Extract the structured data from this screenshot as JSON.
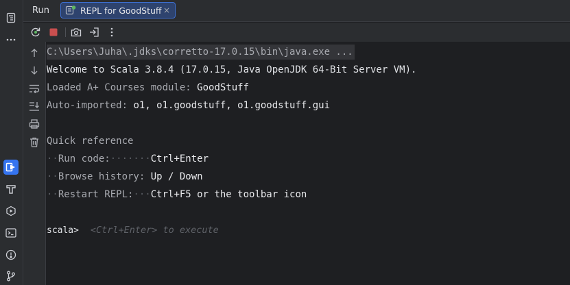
{
  "left_strip": {
    "items": [
      {
        "name": "structure-icon"
      },
      {
        "name": "more-icon"
      },
      {
        "name": "run-icon",
        "active": true
      },
      {
        "name": "build-icon"
      },
      {
        "name": "services-icon"
      },
      {
        "name": "terminal-icon"
      },
      {
        "name": "problems-icon"
      },
      {
        "name": "git-icon"
      }
    ]
  },
  "tabbar": {
    "title": "Run",
    "tab_label": "REPL for GoodStuff",
    "close_glyph": "×"
  },
  "toolbar": {
    "icons": [
      "rerun-icon",
      "stop-icon",
      "screenshot-icon",
      "exit-icon",
      "more-vertical-icon"
    ]
  },
  "gutter": {
    "icons": [
      "arrow-up-icon",
      "arrow-down-icon",
      "soft-wrap-icon",
      "scroll-to-end-icon",
      "print-icon",
      "trash-icon"
    ]
  },
  "console": {
    "command": "C:\\Users\\Juha\\.jdks\\corretto-17.0.15\\bin\\java.exe ...",
    "welcome": "Welcome to Scala 3.8.4 (17.0.15, Java OpenJDK 64-Bit Server VM).",
    "loaded_label": "Loaded A+ Courses module: ",
    "loaded_value": "GoodStuff",
    "imported_label": "Auto-imported: ",
    "imported_value": "o1, o1.goodstuff, o1.goodstuff.gui",
    "quick_ref_heading": "Quick reference",
    "ref_rows": [
      {
        "label": "Run code:",
        "dots": "·······",
        "value": "Ctrl+Enter"
      },
      {
        "label": "Browse history:",
        "dots": " ",
        "value": "Up / Down"
      },
      {
        "label": "Restart REPL:",
        "dots": "···",
        "value": "Ctrl+F5 or the toolbar icon"
      }
    ],
    "prompt": "scala>",
    "input_placeholder": "<Ctrl+Enter> to execute"
  },
  "colors": {
    "background": "#1e1f22",
    "panel": "#2b2d30",
    "accent": "#3574f0",
    "stop_red": "#c94f4f",
    "rerun_green": "#5fb865"
  }
}
